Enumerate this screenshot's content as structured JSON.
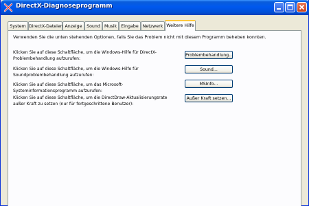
{
  "window": {
    "title": "DirectX-Diagnoseprogramm",
    "controls": [
      "minimize-icon",
      "maximize-icon",
      "close-icon"
    ]
  },
  "tabs": [
    {
      "label": "System",
      "active": false
    },
    {
      "label": "DirectX-Dateien",
      "active": false
    },
    {
      "label": "Anzeige",
      "active": false
    },
    {
      "label": "Sound",
      "active": false
    },
    {
      "label": "Musik",
      "active": false
    },
    {
      "label": "Eingabe",
      "active": false
    },
    {
      "label": "Netzwerk",
      "active": false
    },
    {
      "label": "Weitere Hilfe",
      "active": true
    }
  ],
  "panel": {
    "intro": "Verwenden Sie die unten stehenden Optionen, falls Sie das Problem nicht mit diesem Programm beheben konnten.",
    "rows": [
      {
        "description": "Klicken Sie auf diese Schaltfläche, um die Windows-Hilfe für DirectX-Problembehandlung aufzurufen:",
        "button": "Problembehandlung..."
      },
      {
        "description": "Klicken Sie auf diese Schaltfläche, um die Windows-Hilfe für Soundproblembehandlung aufzurufen:",
        "button": "Sound..."
      },
      {
        "description": "Klicken Sie auf diese Schaltfläche, um das Microsoft-Systeminformationsprogramm aufzurufen:",
        "button": "MSInfo..."
      },
      {
        "description": "Klicken Sie auf diese Schaltfläche, um die DirectDraw-Aktualisierungsrate außer Kraft zu setzen (nur für fortgeschrittene Benutzer):",
        "button": "Außer Kraft setzen..."
      }
    ]
  },
  "colors": {
    "titlebar": "#0058ee",
    "panel_bg": "#fcfcfe",
    "dialog_bg": "#ece9d8",
    "active_tab_accent": "#ffc83c"
  }
}
